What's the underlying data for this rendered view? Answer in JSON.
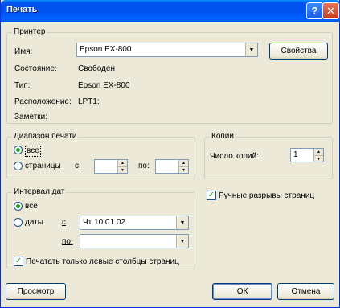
{
  "window": {
    "title": "Печать"
  },
  "printer": {
    "group_label": "Принтер",
    "name_label": "Имя:",
    "name_value": "Epson EX-800",
    "properties_button": "Свойства",
    "status_label": "Состояние:",
    "status_value": "Свободен",
    "type_label": "Тип:",
    "type_value": "Epson EX-800",
    "location_label": "Расположение:",
    "location_value": "LPT1:",
    "comment_label": "Заметки:"
  },
  "range": {
    "group_label": "Диапазон печати",
    "all_label": "все",
    "pages_label": "страницы",
    "from_label": "с:",
    "to_label": "по:",
    "from_value": "",
    "to_value": ""
  },
  "copies": {
    "group_label": "Копии",
    "count_label": "Число копий:",
    "count_value": "1"
  },
  "date_range": {
    "group_label": "Интервал дат",
    "all_label": "все",
    "dates_label": "даты",
    "from_label": "с",
    "to_label": "по:",
    "from_value": "Чт 10.01.02",
    "to_value": ""
  },
  "options": {
    "manual_breaks_label": "Ручные разрывы страниц",
    "left_columns_label": "Печатать только левые столбцы страниц"
  },
  "footer": {
    "preview_button": "Просмотр",
    "ok_button": "ОК",
    "cancel_button": "Отмена"
  }
}
